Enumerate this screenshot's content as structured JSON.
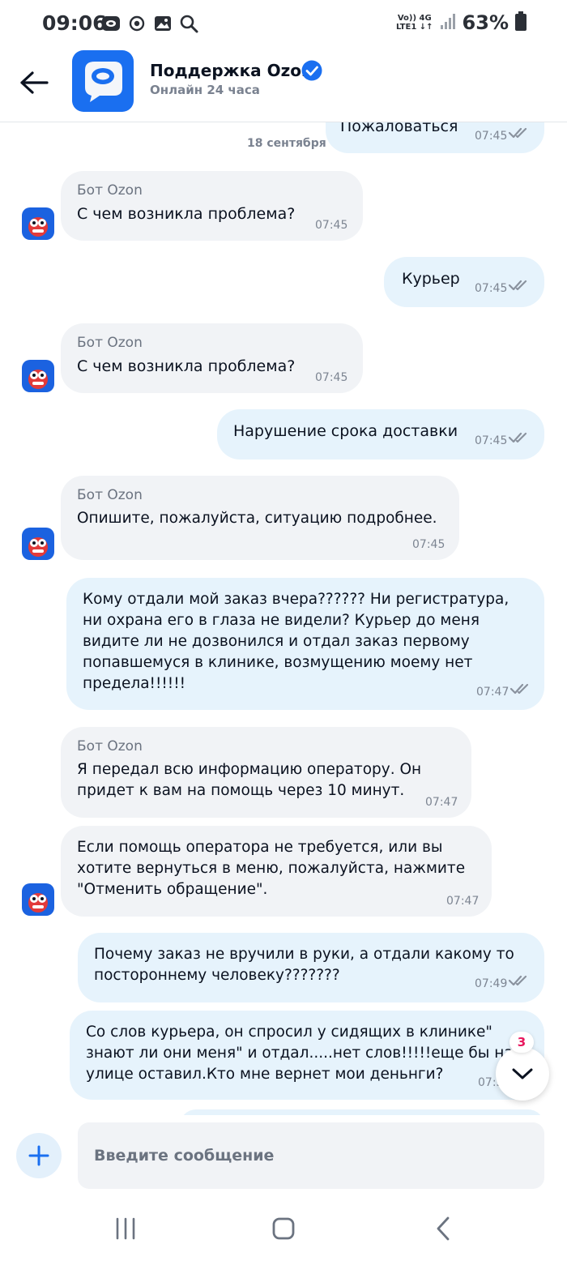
{
  "status_bar": {
    "time": "09:06",
    "network_top": "Vo)) 4G",
    "network_bottom": "LTE1 ↓↑",
    "battery": "63%"
  },
  "header": {
    "title": "Поддержка Ozon",
    "subtitle": "Онлайн 24 часа"
  },
  "chat": {
    "date_label": "18 сентября",
    "messages": [
      {
        "text": "Пожаловаться",
        "time": "07:45"
      },
      {
        "sender": "Бот Ozon",
        "text": "С чем возникла проблема?",
        "time": "07:45"
      },
      {
        "text": "Курьер",
        "time": "07:45"
      },
      {
        "sender": "Бот Ozon",
        "text": "С чем возникла проблема?",
        "time": "07:45"
      },
      {
        "text": "Нарушение срока доставки",
        "time": "07:45"
      },
      {
        "sender": "Бот Ozon",
        "text": "Опишите, пожалуйста, ситуацию подробнее.",
        "time": "07:45"
      },
      {
        "text": "Кому отдали мой заказ вчера?????? Ни регистратура, ни охрана его в глаза не видели? Курьер до меня видите ли не дозвонился и отдал заказ первому попавшемуся в клинике, возмущению моему нет предела!!!!!!",
        "time": "07:47"
      },
      {
        "sender": "Бот Ozon",
        "text": "Я передал всю информацию оператору. Он придет к вам на помощь через 10 минут.",
        "time": "07:47"
      },
      {
        "text": "Если помощь оператора не требуется, или вы хотите вернуться в меню, пожалуйста, нажмите \"Отменить обращение\".",
        "time": "07:47"
      },
      {
        "text": "Почему заказ не вручили в руки, а отдали какому то постороннему человеку???????",
        "time": "07:49"
      },
      {
        "text": "Со слов курьера, он спросил у сидящих в клинике\" знают ли они меня\" и отдал.....нет слов!!!!!еще бы на улице оставил.Кто мне вернет мои деньнги?",
        "time": "07:5"
      }
    ]
  },
  "scroll_button": {
    "unread_count": "3"
  },
  "composer": {
    "placeholder": "Введите сообщение"
  },
  "colors": {
    "accent": "#1a6ff0",
    "incoming_bubble": "#f1f3f6",
    "outgoing_bubble": "#e6f3fc",
    "badge": "#e8175d"
  }
}
